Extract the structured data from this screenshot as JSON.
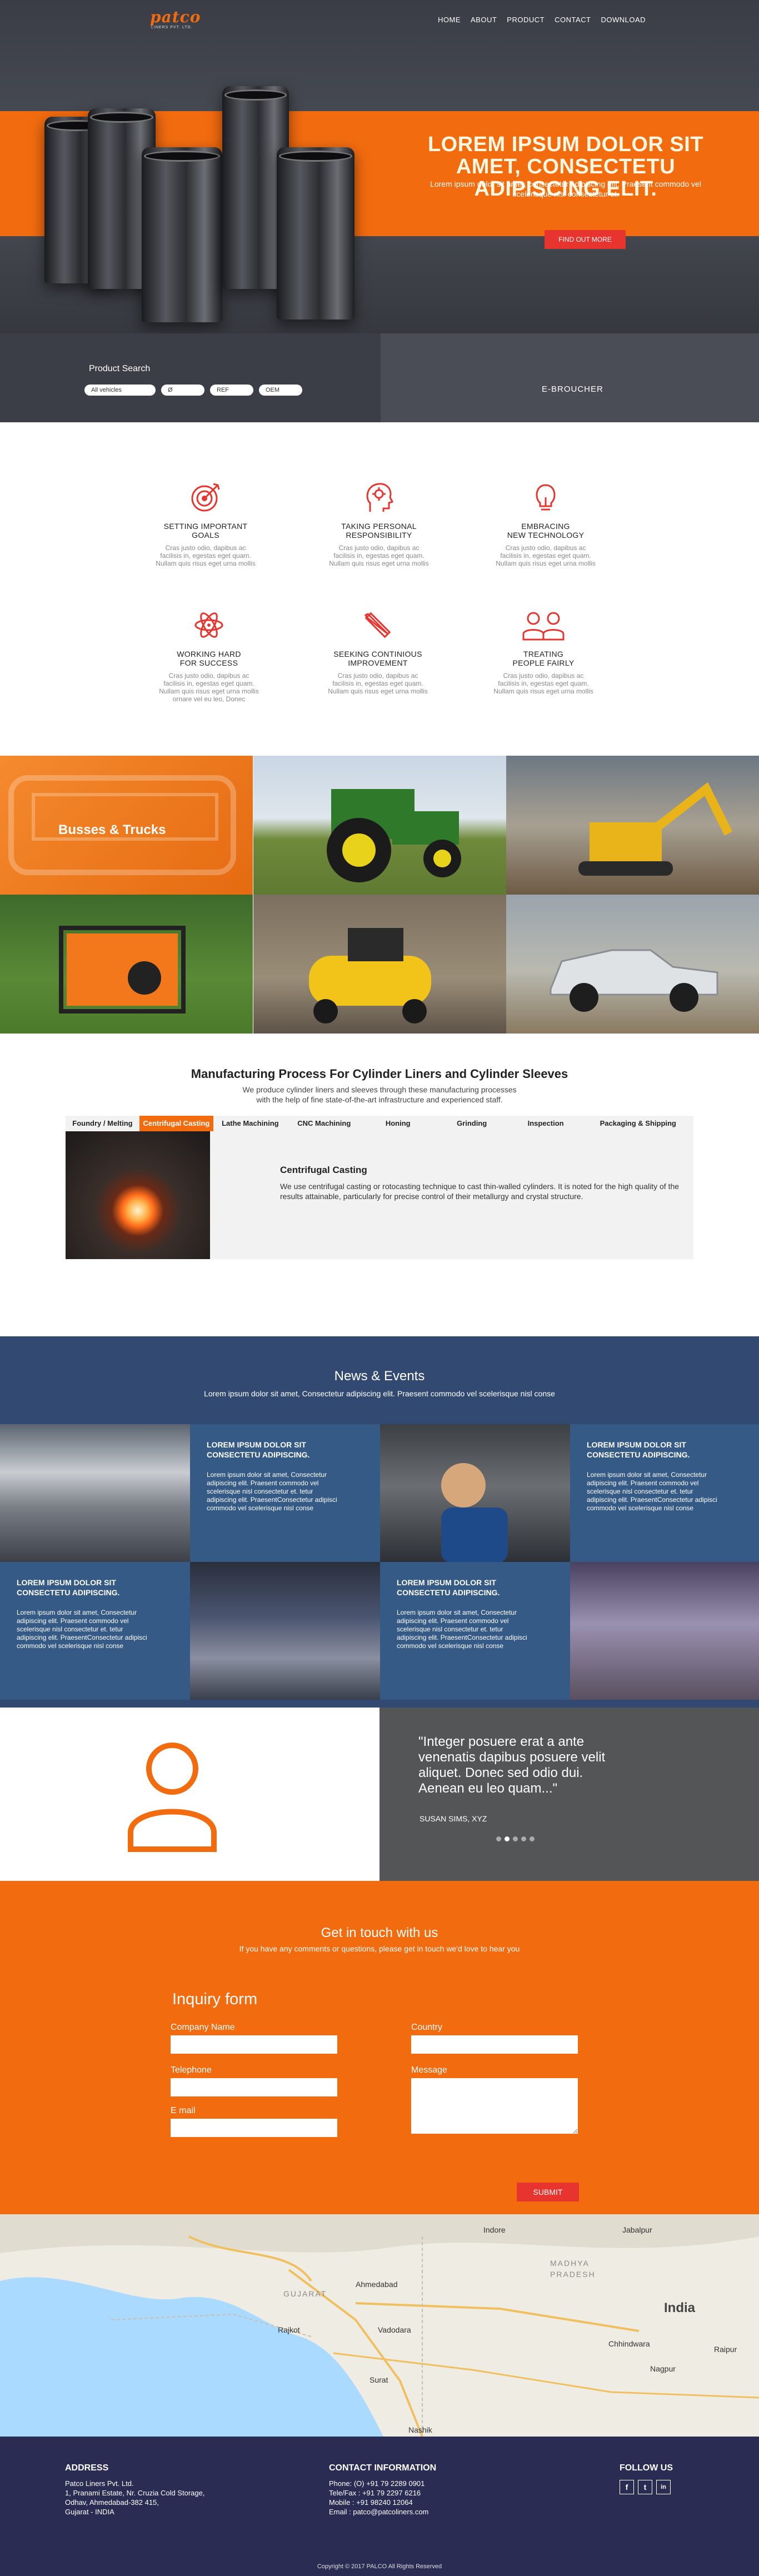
{
  "header": {
    "logo": "patco",
    "logo_tagline": "LINERS PVT. LTD.",
    "nav": [
      "HOME",
      "ABOUT",
      "PRODUCT",
      "CONTACT",
      "DOWNLOAD"
    ]
  },
  "hero": {
    "title": "LOREM IPSUM DOLOR SIT AMET, CONSECTETU ADIPISCING ELIT.",
    "text": "Lorem ipsum dolor sit amet, consectetur adipiscing elit. Praesent commodo vel scelerisque nisl consectetur et.",
    "button": "FIND OUT MORE"
  },
  "search": {
    "label": "Product Search",
    "vehicle_select": "All vehicles",
    "field_diameter": "Ø",
    "field_ref": "REF",
    "field_oem": "OEM"
  },
  "ebook": {
    "label": "E-BROUCHER"
  },
  "features": [
    {
      "title": [
        "SETTING IMPORTANT",
        "GOALS"
      ],
      "text": [
        "Cras justo odio, dapibus ac",
        "facilisis in, egestas eget quam.",
        "Nullam quis risus eget urna mollis"
      ],
      "icon": "target-icon"
    },
    {
      "title": [
        "TAKING PERSONAL",
        "RESPONSIBILITY"
      ],
      "text": [
        "Cras justo odio, dapibus ac",
        "facilisis in, egestas eget quam.",
        "Nullam quis risus eget urna mollis"
      ],
      "icon": "gear-head-icon"
    },
    {
      "title": [
        "EMBRACING",
        "NEW TECHNOLOGY"
      ],
      "text": [
        "Cras justo odio, dapibus ac",
        "facilisis in, egestas eget quam.",
        "Nullam quis risus eget urna mollis"
      ],
      "icon": "lightbulb-icon"
    },
    {
      "title": [
        "WORKING HARD",
        "FOR SUCCESS"
      ],
      "text": [
        "Cras justo odio, dapibus ac",
        "facilisis in, egestas eget quam.",
        "Nullam quis risus eget urna mollis",
        "ornare vel eu leo, Donec"
      ],
      "icon": "atom-icon"
    },
    {
      "title": [
        "SEEKING CONTINIOUS",
        "IMPROVEMENT"
      ],
      "text": [
        "Cras justo odio, dapibus ac",
        "facilisis in, egestas eget quam.",
        "Nullam quis risus eget urna mollis"
      ],
      "icon": "pencil-ruler-icon"
    },
    {
      "title": [
        "TREATING",
        "PEOPLE FAIRLY"
      ],
      "text": [
        "Cras justo odio, dapibus ac",
        "facilisis in, egestas eget quam.",
        "Nullam quis risus eget urna mollis"
      ],
      "icon": "people-icon"
    }
  ],
  "gallery": {
    "label": "Busses & Trucks"
  },
  "process": {
    "title": "Manufacturing Process For Cylinder Liners and Cylinder Sleeves",
    "subtitle": [
      "We produce cylinder liners and sleeves through these manufacturing processes",
      "with the help of fine state-of-the-art infrastructure and experienced staff."
    ],
    "tabs": [
      "Foundry / Melting",
      "Centrifugal Casting",
      "Lathe Machining",
      "CNC Machining",
      "Honing",
      "Grinding",
      "Inspection",
      "Packaging & Shipping"
    ],
    "active_tab": "Centrifugal Casting",
    "panel_title": "Centrifugal Casting",
    "panel_text": "We use centrifugal casting or rotocasting technique to cast thin-walled cylinders. It is noted for the high quality of the results attainable, particularly for precise control of their metallurgy and crystal structure."
  },
  "news": {
    "title": "News & Events",
    "subtitle": "Lorem ipsum dolor sit amet, Consectetur adipiscing elit. Praesent commodo vel scelerisque nisl conse",
    "items": [
      {
        "title": [
          "LOREM IPSUM DOLOR SIT",
          "CONSECTETU ADIPISCING."
        ],
        "text": [
          "Lorem ipsum dolor sit amet, Consectetur",
          "adipiscing elit. Praesent commodo vel",
          "scelerisque nisl consectetur et. tetur",
          "adipiscing elit. PraesentConsectetur adipisci",
          "commodo vel scelerisque nisl conse"
        ]
      },
      {
        "title": [
          "LOREM IPSUM DOLOR SIT",
          "CONSECTETU ADIPISCING."
        ],
        "text": [
          "Lorem ipsum dolor sit amet, Consectetur",
          "adipiscing elit. Praesent commodo vel",
          "scelerisque nisl consectetur et. tetur",
          "adipiscing elit. PraesentConsectetur adipisci",
          "commodo vel scelerisque nisl conse"
        ]
      },
      {
        "title": [
          "LOREM IPSUM DOLOR SIT",
          "CONSECTETU ADIPISCING."
        ],
        "text": [
          "Lorem ipsum dolor sit amet, Consectetur",
          "adipiscing elit. Praesent commodo vel",
          "scelerisque nisl consectetur et. tetur",
          "adipiscing elit. PraesentConsectetur adipisci",
          "commodo vel scelerisque nisl conse"
        ]
      },
      {
        "title": [
          "LOREM IPSUM DOLOR SIT",
          "CONSECTETU ADIPISCING."
        ],
        "text": [
          "Lorem ipsum dolor sit amet, Consectetur",
          "adipiscing elit. Praesent commodo vel",
          "scelerisque nisl consectetur et. tetur",
          "adipiscing elit. PraesentConsectetur adipisci",
          "commodo vel scelerisque nisl conse"
        ]
      }
    ]
  },
  "testimonial": {
    "quote": "\"Integer posuere erat a ante venenatis dapibus posuere velit aliquet. Donec sed odio dui. Aenean eu leo quam...\"",
    "author": "SUSAN SIMS, XYZ",
    "dots": 5,
    "active_dot": 2
  },
  "contact": {
    "title": "Get in touch with us",
    "subtitle": "If you have any comments or questions, please get in touch we'd love to hear you",
    "form_title": "Inquiry form",
    "company_label": "Company Name",
    "country_label": "Country",
    "telephone_label": "Telephone",
    "message_label": "Message",
    "email_label": "E mail",
    "submit": "SUBMIT"
  },
  "map": {
    "cities": [
      "GUJARAT",
      "Ahmedabad",
      "Rajkot",
      "Vadodara",
      "Surat",
      "Nashik",
      "MADHYA",
      "PRADESH",
      "India",
      "Jabalpur",
      "Indore",
      "Nagpur",
      "Raipur",
      "Chhindwara"
    ]
  },
  "footer": {
    "address_title": "ADDRESS",
    "address_lines": [
      "Patco Liners Pvt. Ltd.",
      "1, Pranami Estate, Nr. Cruzia Cold Storage,",
      "Odhav, Ahmedabad-382 415,",
      "Gujarat - INDIA"
    ],
    "contact_title": "CONTACT INFORMATION",
    "contact_lines": [
      "Phone: (O) +91 79 2289 0901",
      "Tele/Fax : +91 79 2297 6216",
      "Mobile : +91 98240 12064",
      "Email : patco@patcoliners.com"
    ],
    "follow_title": "FOLLOW US",
    "social": [
      "f",
      "t",
      "in"
    ],
    "copyright": "Copyright © 2017 PALCO All Rights Reserved"
  },
  "colors": {
    "accent": "#f26b0f",
    "navy": "#324a72",
    "footer": "#2b2c54",
    "red_button": "#e8342f"
  }
}
